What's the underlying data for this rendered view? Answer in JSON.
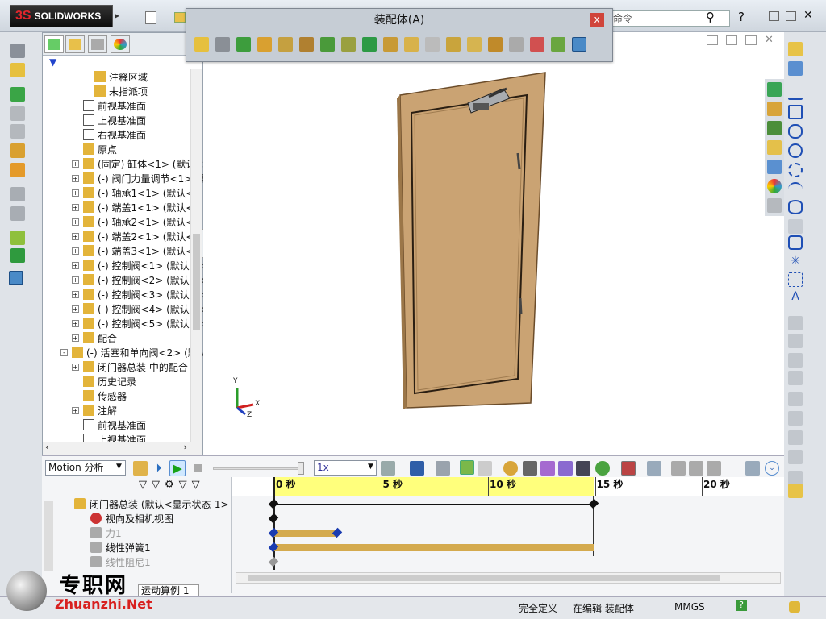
{
  "app": {
    "logo_text": "SOLIDWORKS",
    "logo_prefix": "3S"
  },
  "assembly_window": {
    "title": "装配体(A)",
    "close_label": "x"
  },
  "search": {
    "text": "命令"
  },
  "tree": {
    "items": [
      {
        "label": "注释区域",
        "indent": 3
      },
      {
        "label": "未指派项",
        "indent": 3
      },
      {
        "label": "前视基准面",
        "indent": 2
      },
      {
        "label": "上视基准面",
        "indent": 2
      },
      {
        "label": "右视基准面",
        "indent": 2
      },
      {
        "label": "原点",
        "indent": 2
      },
      {
        "label": "(固定) 缸体<1> (默认<",
        "indent": 2,
        "exp": "+"
      },
      {
        "label": "(-) 阀门力量调节<1> (默",
        "indent": 2,
        "exp": "+"
      },
      {
        "label": "(-) 轴承1<1> (默认<<",
        "indent": 2,
        "exp": "+"
      },
      {
        "label": "(-) 端盖1<1> (默认<<",
        "indent": 2,
        "exp": "+"
      },
      {
        "label": "(-) 轴承2<1> (默认<<",
        "indent": 2,
        "exp": "+"
      },
      {
        "label": "(-) 端盖2<1> (默认<<",
        "indent": 2,
        "exp": "+"
      },
      {
        "label": "(-) 端盖3<1> (默认<<",
        "indent": 2,
        "exp": "+"
      },
      {
        "label": "(-) 控制阀<1> (默认<<",
        "indent": 2,
        "exp": "+"
      },
      {
        "label": "(-) 控制阀<2> (默认<<",
        "indent": 2,
        "exp": "+"
      },
      {
        "label": "(-) 控制阀<3> (默认<<",
        "indent": 2,
        "exp": "+"
      },
      {
        "label": "(-) 控制阀<4> (默认<<",
        "indent": 2,
        "exp": "+"
      },
      {
        "label": "(-) 控制阀<5> (默认<<",
        "indent": 2,
        "exp": "+"
      },
      {
        "label": "配合",
        "indent": 2,
        "exp": "+"
      },
      {
        "label": "(-) 活塞和单向阀<2> (默认",
        "indent": 1,
        "exp": "-"
      },
      {
        "label": "闭门器总装 中的配合",
        "indent": 2,
        "exp": "+"
      },
      {
        "label": "历史记录",
        "indent": 2
      },
      {
        "label": "传感器",
        "indent": 2
      },
      {
        "label": "注解",
        "indent": 2,
        "exp": "+"
      },
      {
        "label": "前视基准面",
        "indent": 2
      },
      {
        "label": "上视基准面",
        "indent": 2
      }
    ]
  },
  "motion": {
    "type": "Motion 分析",
    "speed": "1x",
    "ticks": [
      "0 秒",
      "5 秒",
      "10 秒",
      "15 秒",
      "20 秒"
    ],
    "rows": [
      {
        "label": "闭门器总装 (默认<显示状态-1>",
        "exp": "-"
      },
      {
        "label": "视向及相机视图"
      },
      {
        "label": "力1",
        "dim": true
      },
      {
        "label": "线性弹簧1"
      },
      {
        "label": "线性阻尼1",
        "dim": true
      }
    ],
    "tab": "运动算例 1"
  },
  "axes": {
    "y": "Y",
    "x": "X",
    "z": "Z"
  },
  "status": {
    "defined": "完全定义",
    "editing": "在编辑 装配体",
    "units": "MMGS",
    "help": "?"
  },
  "watermark": {
    "cn": "专职网",
    "en": "Zhuanzhi.Net"
  },
  "colors": {
    "accent_green": "#2fa84a",
    "timeline_yellow": "#ffff7c",
    "bar_gold": "#d4aa4e",
    "door_wood": "#c9a272"
  }
}
